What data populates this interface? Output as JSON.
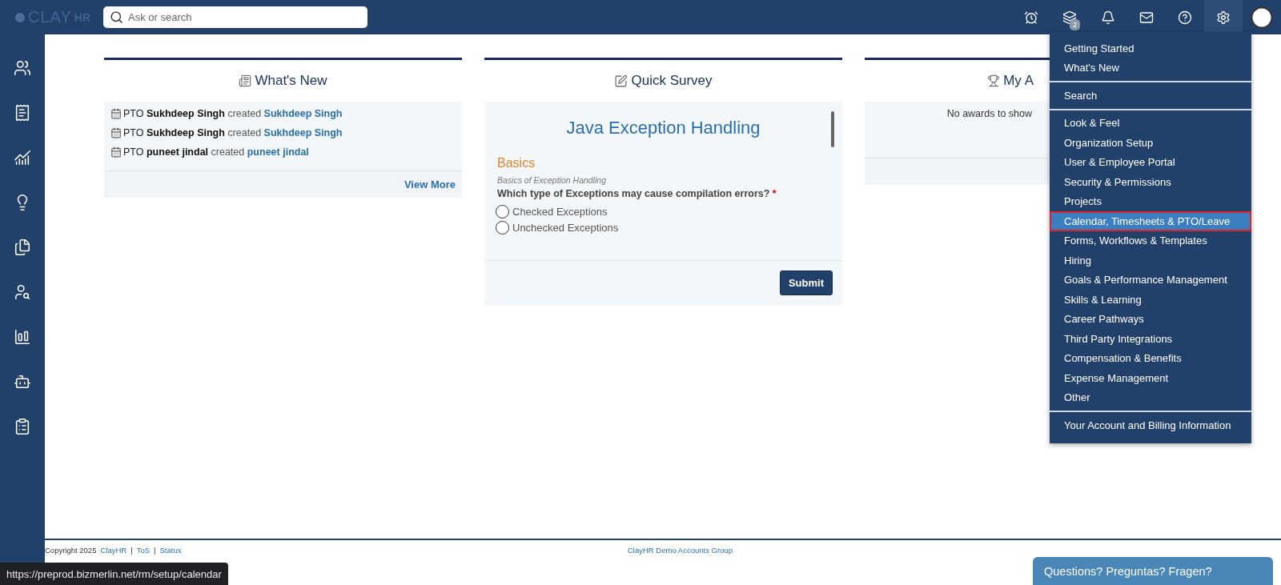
{
  "top_bar": {
    "logo": {
      "main": "CLAY",
      "suffix": "HR"
    },
    "search": {
      "placeholder": "Ask or search"
    },
    "icons": [
      {
        "kind": "alarm",
        "selected": false
      },
      {
        "kind": "layers",
        "selected": false,
        "badge": "2"
      },
      {
        "kind": "bell",
        "selected": false
      },
      {
        "kind": "mail",
        "selected": false
      },
      {
        "kind": "help",
        "selected": false
      },
      {
        "kind": "settings",
        "selected": true
      },
      {
        "kind": "user",
        "selected": false
      }
    ]
  },
  "sidebar": {
    "items": [
      {
        "kind": "people"
      },
      {
        "kind": "payroll"
      },
      {
        "kind": "growth"
      },
      {
        "kind": "idea"
      },
      {
        "kind": "documents"
      },
      {
        "kind": "search-person"
      },
      {
        "kind": "report"
      },
      {
        "kind": "bot"
      },
      {
        "kind": "checklist"
      }
    ]
  },
  "whats_new": {
    "title": "What's New",
    "items": [
      {
        "type": "PTO",
        "actor": "Sukhdeep Singh",
        "action": "created",
        "target": "Sukhdeep Singh"
      },
      {
        "type": "PTO",
        "actor": "Sukhdeep Singh",
        "action": "created",
        "target": "Sukhdeep Singh"
      },
      {
        "type": "PTO",
        "actor": "puneet jindal",
        "action": "created",
        "target": "puneet jindal"
      }
    ],
    "view_more": "View More"
  },
  "quick_survey": {
    "title": "Quick Survey",
    "survey_title": "Java Exception Handling",
    "section": "Basics",
    "section_description": "Basics of Exception Handling",
    "question": "Which type of Exceptions may cause compilation errors?",
    "required_mark": "*",
    "options": [
      {
        "label": "Checked Exceptions",
        "selected": false
      },
      {
        "label": "Unchecked Exceptions",
        "selected": false
      }
    ],
    "submit": "Submit"
  },
  "awards": {
    "title": "My A",
    "empty_text": "No awards to show"
  },
  "settings_menu": {
    "groups": [
      {
        "items": [
          {
            "label": "Getting Started",
            "selected": false
          },
          {
            "label": "What's New",
            "selected": false
          }
        ]
      },
      {
        "items": [
          {
            "label": "Search",
            "selected": false
          }
        ]
      },
      {
        "items": [
          {
            "label": "Look & Feel",
            "selected": false
          },
          {
            "label": "Organization Setup",
            "selected": false
          },
          {
            "label": "User & Employee Portal",
            "selected": false
          },
          {
            "label": "Security & Permissions",
            "selected": false
          },
          {
            "label": "Projects",
            "selected": false
          },
          {
            "label": "Calendar, Timesheets & PTO/Leave",
            "selected": true
          },
          {
            "label": "Forms, Workflows & Templates",
            "selected": false
          },
          {
            "label": "Hiring",
            "selected": false
          },
          {
            "label": "Goals & Performance Management",
            "selected": false
          },
          {
            "label": "Skills & Learning",
            "selected": false
          },
          {
            "label": "Career Pathways",
            "selected": false
          },
          {
            "label": "Third Party Integrations",
            "selected": false
          },
          {
            "label": "Compensation & Benefits",
            "selected": false
          },
          {
            "label": "Expense Management",
            "selected": false
          },
          {
            "label": "Other",
            "selected": false
          }
        ]
      },
      {
        "items": [
          {
            "label": "Your Account and Billing Information",
            "selected": false
          }
        ]
      }
    ]
  },
  "footer": {
    "copyright": "Copyright 2025",
    "links": [
      "ClayHR",
      "ToS",
      "Status"
    ],
    "separator": "|",
    "center": "ClayHR Demo Accounts Group"
  },
  "status_url": "https://preprod.bizmerlin.net/rm/setup/calendar",
  "chat_button": "Questions? Preguntas? Fragen?"
}
